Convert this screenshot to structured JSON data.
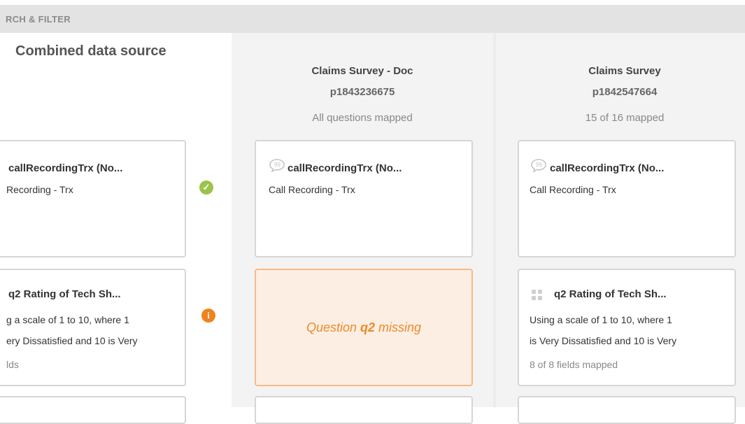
{
  "topbar": {
    "label": "RCH & FILTER"
  },
  "combined": {
    "title": "Combined data source",
    "rows": [
      {
        "title": "callRecordingTrx (No...",
        "text1": "Recording - Trx"
      },
      {
        "title": "q2 Rating of Tech Sh...",
        "text1": "g a scale of 1 to 10, where 1",
        "text2": "ery Dissatisfied and 10 is Very",
        "sub": "lds"
      }
    ]
  },
  "sources": [
    {
      "title": "Claims Survey - Doc",
      "id": "p1843236675",
      "status": "All questions mapped",
      "cards": [
        {
          "title": "callRecordingTrx (No...",
          "text1": "Call Recording - Trx"
        }
      ],
      "missing": {
        "prefix": "Question ",
        "q": "q2",
        "suffix": " missing"
      }
    },
    {
      "title": "Claims Survey",
      "id": "p1842547664",
      "status": "15 of 16 mapped",
      "cards": [
        {
          "title": "callRecordingTrx (No...",
          "text1": "Call Recording - Trx"
        },
        {
          "title": "q2 Rating of Tech Sh...",
          "text1": "Using a scale of 1 to 10, where 1",
          "text2": "is Very Dissatisfied and 10 is Very",
          "sub": "8 of 8 fields mapped"
        }
      ]
    }
  ],
  "status_icons": {
    "row1": "✓",
    "row2": "i"
  },
  "icons": {
    "open_ended": "speech-bubble-icon",
    "rating": "grid-icon"
  },
  "colors": {
    "ok": "#9bc34a",
    "warn": "#ee8320",
    "missing_bg": "#fdeee3",
    "missing_text": "#ee8a2a"
  }
}
